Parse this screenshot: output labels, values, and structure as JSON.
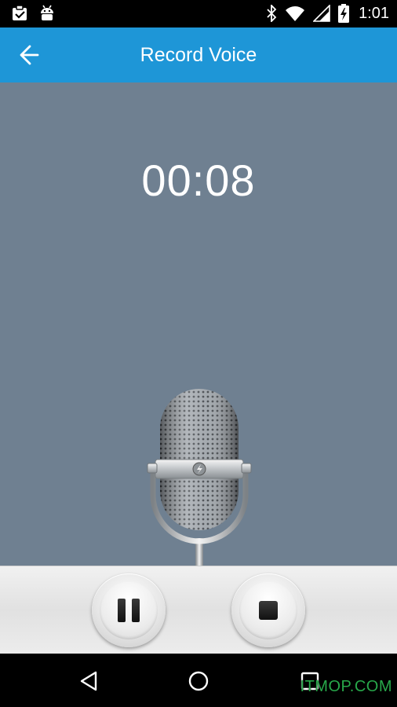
{
  "status_bar": {
    "time": "1:01",
    "icons_left": [
      "clipboard-check-icon",
      "android-debug-icon"
    ],
    "icons_right": [
      "bluetooth-icon",
      "wifi-icon",
      "signal-icon",
      "battery-charging-icon"
    ]
  },
  "app_bar": {
    "title": "Record Voice",
    "back_icon": "arrow-back-icon",
    "color": "#1e96d7"
  },
  "recorder": {
    "elapsed": "00:08",
    "background_color": "#6f8091",
    "image": "microphone-icon"
  },
  "controls": {
    "pause_icon": "pause-icon",
    "stop_icon": "stop-icon"
  },
  "nav_bar": {
    "icons": [
      "nav-back-icon",
      "nav-home-icon",
      "nav-recents-icon"
    ]
  },
  "watermark": "ITMOP.COM"
}
